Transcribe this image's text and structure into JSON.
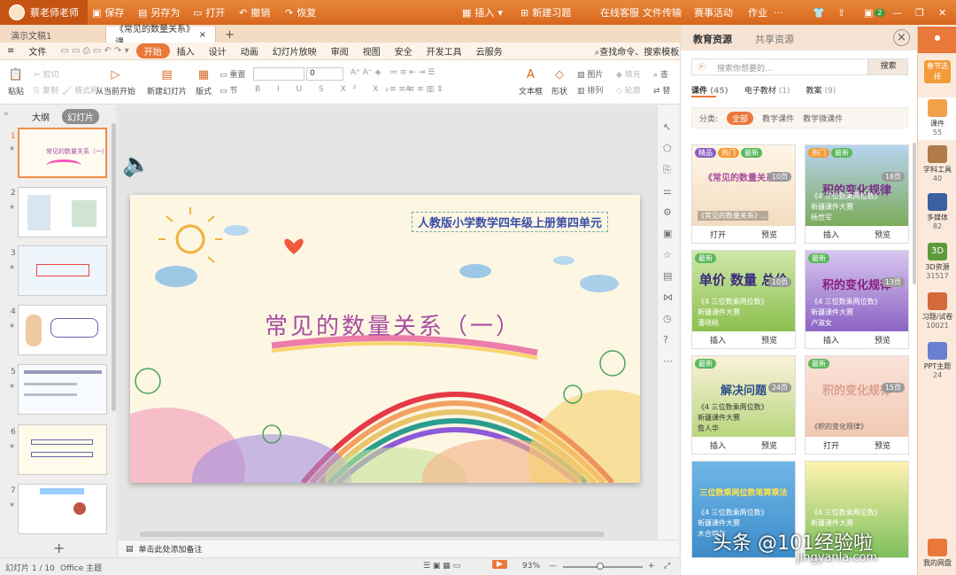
{
  "titlebar": {
    "user": "蔡老师老师",
    "save": "保存",
    "saveas": "另存为",
    "open": "打开",
    "undo": "撤销",
    "redo": "恢复",
    "insert": "插入",
    "new_exercise": "新建习题",
    "online_service": "在线客服",
    "file_transfer": "文件传输",
    "contest": "赛事活动",
    "homework": "作业",
    "more": "···",
    "notify_count": "2"
  },
  "tabs": [
    {
      "label": "演示文稿1"
    },
    {
      "label": "《常见的数量关系》课..."
    }
  ],
  "ribbon_tabs": [
    "文件",
    "开始",
    "插入",
    "设计",
    "动画",
    "幻灯片放映",
    "审阅",
    "视图",
    "安全",
    "开发工具",
    "云服务"
  ],
  "ribbon_search": "查找命令、搜索模板",
  "ribbon": {
    "paste": "粘贴",
    "cut": "剪切",
    "copy": "复制",
    "format_painter": "格式刷",
    "from_current": "从当前开始",
    "new_slide": "新建幻灯片",
    "layout": "版式",
    "reset": "重置",
    "section": "节",
    "font_size": "0",
    "textbox": "文本框",
    "shape": "形状",
    "picture": "图片",
    "arrange": "排列",
    "fill": "填充",
    "outline": "轮廓",
    "find": "查",
    "replace": "替"
  },
  "left_panel": {
    "outline": "大纲",
    "slides": "幻灯片"
  },
  "thumbnails": [
    {
      "num": "1"
    },
    {
      "num": "2"
    },
    {
      "num": "3"
    },
    {
      "num": "4"
    },
    {
      "num": "5"
    },
    {
      "num": "6"
    },
    {
      "num": "7"
    }
  ],
  "slide": {
    "subtitle": "人教版小学数学四年级上册第四单元",
    "title": "常见的数量关系（一）"
  },
  "notes": "单击此处添加备注",
  "status": {
    "slide": "幻灯片 1 / 10",
    "theme": "Office 主题",
    "zoom": "93%"
  },
  "resources": {
    "tab1": "教育资源",
    "tab2": "共享资源",
    "search_placeholder": "搜索你想要的...",
    "search_btn": "搜索",
    "cats": [
      {
        "label": "课件",
        "count": "(45)"
      },
      {
        "label": "电子教材",
        "count": "(1)"
      },
      {
        "label": "教案",
        "count": "(9)"
      }
    ],
    "filter_label": "分类:",
    "filters": [
      "全部",
      "教学课件",
      "教学微课件"
    ],
    "cards": [
      {
        "title": "《常见的数量关系》",
        "pages": "10页",
        "caption": "《常见的数量关系》...",
        "source": "",
        "author": "",
        "a1": "打开",
        "a2": "预览",
        "b1": "精品",
        "b2": "热门",
        "b3": "最新"
      },
      {
        "title": "积的变化规律",
        "pages": "18页",
        "caption": "《4 三位数乘两位数》",
        "source": "新疆课件大赛",
        "author": "杨世军",
        "a1": "插入",
        "a2": "预览",
        "b1": "热门",
        "b2": "最新",
        "b3": ""
      },
      {
        "title": "单价 数量 总价",
        "pages": "10页",
        "caption": "《4 三位数乘两位数》",
        "source": "新疆课件大赛",
        "author": "潘晓桃",
        "a1": "插入",
        "a2": "预览",
        "b1": "最新",
        "b2": "",
        "b3": ""
      },
      {
        "title": "积的变化规律",
        "pages": "13页",
        "caption": "《4 三位数乘两位数》",
        "source": "新疆课件大赛",
        "author": "卢淑女",
        "a1": "插入",
        "a2": "预览",
        "b1": "最新",
        "b2": "",
        "b3": ""
      },
      {
        "title": "解决问题",
        "pages": "24页",
        "caption": "《4 三位数乘两位数》",
        "source": "新疆课件大赛",
        "author": "詹人华",
        "a1": "插入",
        "a2": "预览",
        "b1": "最新",
        "b2": "",
        "b3": ""
      },
      {
        "title": "积的变化规律",
        "pages": "15页",
        "caption": "《积的变化规律》",
        "source": "",
        "author": "",
        "a1": "打开",
        "a2": "预览",
        "b1": "最新",
        "b2": "",
        "b3": ""
      },
      {
        "title": "三位数乘两位数笔算乘法",
        "pages": "",
        "caption": "《4 三位数乘两位数》",
        "source": "新疆课件大赛",
        "author": "木合塔尔",
        "a1": "",
        "a2": "",
        "b1": "",
        "b2": "",
        "b3": ""
      },
      {
        "title": "",
        "pages": "",
        "caption": "《4 三位数乘两位数》",
        "source": "新疆课件大赛",
        "author": "",
        "a1": "",
        "a2": "",
        "b1": "",
        "b2": "",
        "b3": ""
      }
    ]
  },
  "rail": [
    {
      "label": "春节选择",
      "count": ""
    },
    {
      "label": "课件",
      "count": "55"
    },
    {
      "label": "学科工具",
      "count": "40"
    },
    {
      "label": "多媒体",
      "count": "82"
    },
    {
      "label": "3D资源",
      "count": "31517"
    },
    {
      "label": "习题/试卷",
      "count": "10021"
    },
    {
      "label": "PPT主题",
      "count": "24"
    },
    {
      "label": "我的网盘",
      "count": ""
    }
  ],
  "watermark": {
    "line1": "头条 @101经验啦",
    "line2": "jingyanla.com"
  }
}
